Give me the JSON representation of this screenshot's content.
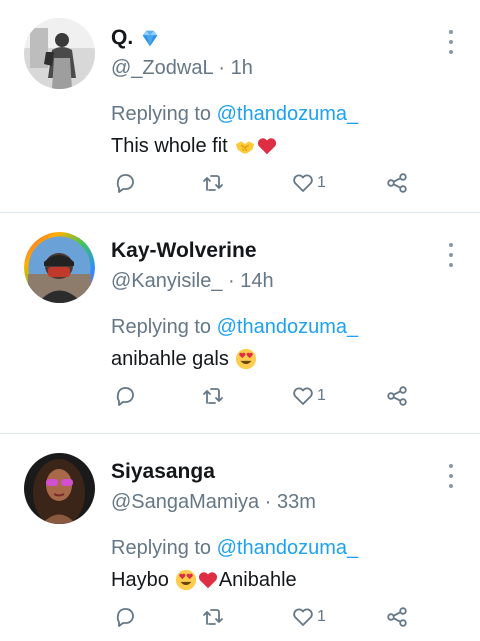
{
  "tweets": [
    {
      "name": "Q.",
      "verified_emoji": "blue-diamond",
      "handle": "@_ZodwaL",
      "separator": "·",
      "time": "1h",
      "replying_label": "Replying to",
      "replying_to": "@thandozuma_",
      "text_before": "This whole fit",
      "text_after": "",
      "emojis": [
        "handshake",
        "red-heart"
      ],
      "like_count": "1"
    },
    {
      "name": "Kay-Wolverine",
      "handle": "@Kanyisile_",
      "separator": "·",
      "time": "14h",
      "replying_label": "Replying to",
      "replying_to": "@thandozuma_",
      "text_before": "anibahle gals",
      "text_after": "",
      "emojis": [
        "heart-eyes"
      ],
      "like_count": "1"
    },
    {
      "name": "Siyasanga",
      "handle": "@SangaMamiya",
      "separator": "·",
      "time": "33m",
      "replying_label": "Replying to",
      "replying_to": "@thandozuma_",
      "text_before": "Haybo",
      "text_after": "Anibahle",
      "emojis": [
        "heart-eyes",
        "red-heart"
      ],
      "like_count": "1"
    }
  ],
  "colors": {
    "mention": "#1da1f2",
    "secondary_text": "#657786",
    "primary_text": "#14171a",
    "divider": "#e1e8ed"
  }
}
